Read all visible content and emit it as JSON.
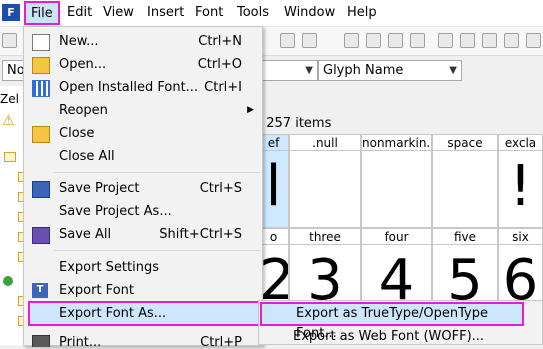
{
  "app": {
    "icon_letter": "F",
    "project_label": "Zel",
    "grid_info": ", 257 items"
  },
  "menubar": {
    "items": [
      "File",
      "Edit",
      "View",
      "Insert",
      "Font",
      "Tools",
      "Window",
      "Help"
    ]
  },
  "toolbar": {
    "combo_left_value": "No",
    "combo_right_value": "Glyph Name"
  },
  "grid": {
    "row1_heads": [
      "ef",
      ".null",
      "nonmarkin...",
      "space",
      "excla"
    ],
    "row1_glyphs": [
      "l",
      "",
      "",
      "",
      "!"
    ],
    "row2_heads": [
      "o",
      "three",
      "four",
      "five",
      "six"
    ],
    "row2_glyphs": [
      "2",
      "3",
      "4",
      "5",
      "6"
    ]
  },
  "file_menu": {
    "items": [
      {
        "label": "New...",
        "shortcut": "Ctrl+N",
        "icon": "new-document-icon"
      },
      {
        "label": "Open...",
        "shortcut": "Ctrl+O",
        "icon": "open-folder-icon"
      },
      {
        "label": "Open Installed Font...",
        "shortcut": "Ctrl+I",
        "icon": "installed-font-icon"
      },
      {
        "label": "Reopen",
        "shortcut": "",
        "icon": ""
      },
      {
        "label": "Close",
        "shortcut": "",
        "icon": "close-folder-icon"
      },
      {
        "label": "Close All",
        "shortcut": "",
        "icon": ""
      },
      {
        "label": "Save Project",
        "shortcut": "Ctrl+S",
        "icon": "save-disk-icon"
      },
      {
        "label": "Save Project As...",
        "shortcut": "",
        "icon": ""
      },
      {
        "label": "Save All",
        "shortcut": "Shift+Ctrl+S",
        "icon": "save-all-icon"
      },
      {
        "label": "Export Settings",
        "shortcut": "",
        "icon": ""
      },
      {
        "label": "Export Font",
        "shortcut": "",
        "icon": "export-font-icon"
      },
      {
        "label": "Export Font As...",
        "shortcut": "",
        "icon": ""
      },
      {
        "label": "Print...",
        "shortcut": "Ctrl+P",
        "icon": "print-icon"
      }
    ]
  },
  "submenu": {
    "items": [
      "Export as TrueType/OpenType Font...",
      "Export as Web Font (WOFF)..."
    ]
  },
  "colors": {
    "highlight_border": "#e81ad8",
    "highlight_fill": "#cde6fb"
  }
}
